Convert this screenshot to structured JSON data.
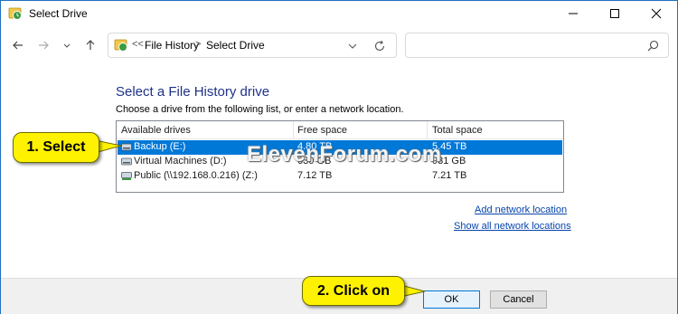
{
  "window": {
    "title": "Select Drive",
    "icon": "file-history-icon"
  },
  "navigation": {
    "back_icon": "arrow-left-icon",
    "forward_icon": "arrow-right-icon",
    "recent_icon": "chevron-down-icon",
    "up_icon": "arrow-up-icon",
    "address": {
      "icon": "control-panel-icon",
      "overflow": "<<",
      "crumbs": [
        "File History",
        "Select Drive"
      ],
      "separator": ">"
    },
    "search": {
      "placeholder": ""
    }
  },
  "content": {
    "heading": "Select a File History drive",
    "instructions": "Choose a drive from the following list, or enter a network location.",
    "drives_table": {
      "columns": [
        "Available drives",
        "Free space",
        "Total space"
      ],
      "rows": [
        {
          "name": "Backup (E:)",
          "free": "4.80 TB",
          "total": "5.45 TB",
          "selected": true,
          "icon": "drive-icon"
        },
        {
          "name": "Virtual Machines (D:)",
          "free": "630 GB",
          "total": "931 GB",
          "selected": false,
          "icon": "drive-icon"
        },
        {
          "name": "Public (\\\\192.168.0.216) (Z:)",
          "free": "7.12 TB",
          "total": "7.21 TB",
          "selected": false,
          "icon": "network-drive-icon"
        }
      ]
    },
    "links": {
      "add_network": "Add network location",
      "show_all_network": "Show all network locations"
    }
  },
  "footer": {
    "ok_label": "OK",
    "cancel_label": "Cancel"
  },
  "annotations": {
    "step1": "1. Select",
    "step2": "2. Click on",
    "color": "#fff200"
  },
  "watermark": "ElevenForum.com",
  "colors": {
    "heading": "#1e3287",
    "selection": "#0078d7",
    "link": "#0645ad"
  }
}
